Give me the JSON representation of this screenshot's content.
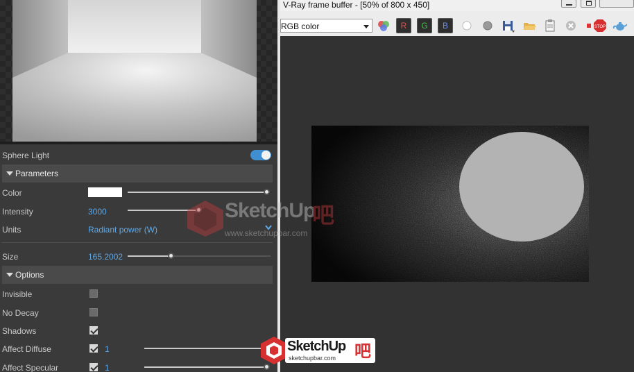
{
  "left_panel": {
    "light_name": "Sphere Light",
    "enabled": true,
    "parameters": {
      "title": "Parameters",
      "color_label": "Color",
      "color_value": "#ffffff",
      "intensity_label": "Intensity",
      "intensity_value": "3000",
      "units_label": "Units",
      "units_value": "Radiant power (W)",
      "size_label": "Size",
      "size_value": "165.2002"
    },
    "options": {
      "title": "Options",
      "invisible_label": "Invisible",
      "invisible_checked": false,
      "no_decay_label": "No Decay",
      "no_decay_checked": false,
      "shadows_label": "Shadows",
      "shadows_checked": true,
      "affect_diffuse_label": "Affect Diffuse",
      "affect_diffuse_checked": true,
      "affect_diffuse_value": "1",
      "affect_specular_label": "Affect Specular",
      "affect_specular_checked": true,
      "affect_specular_value": "1"
    }
  },
  "vfb": {
    "title": "V-Ray frame buffer - [50% of 800 x 450]",
    "channel": "RGB color",
    "channel_buttons": [
      "R",
      "G",
      "B"
    ],
    "toolbar_icons": [
      "color-correction-icon",
      "white-circle-icon",
      "gray-circle-icon",
      "save-icon",
      "open-folder-icon",
      "clipboard-icon",
      "clear-icon",
      "red-dot-icon",
      "stop-icon",
      "teapot-icon"
    ],
    "accent": "#3f8fd2"
  },
  "watermark": {
    "brand": "SketchUp",
    "suffix": "吧",
    "url": "www.sketchupbar.com",
    "small_url": "sketchupbar.com"
  }
}
